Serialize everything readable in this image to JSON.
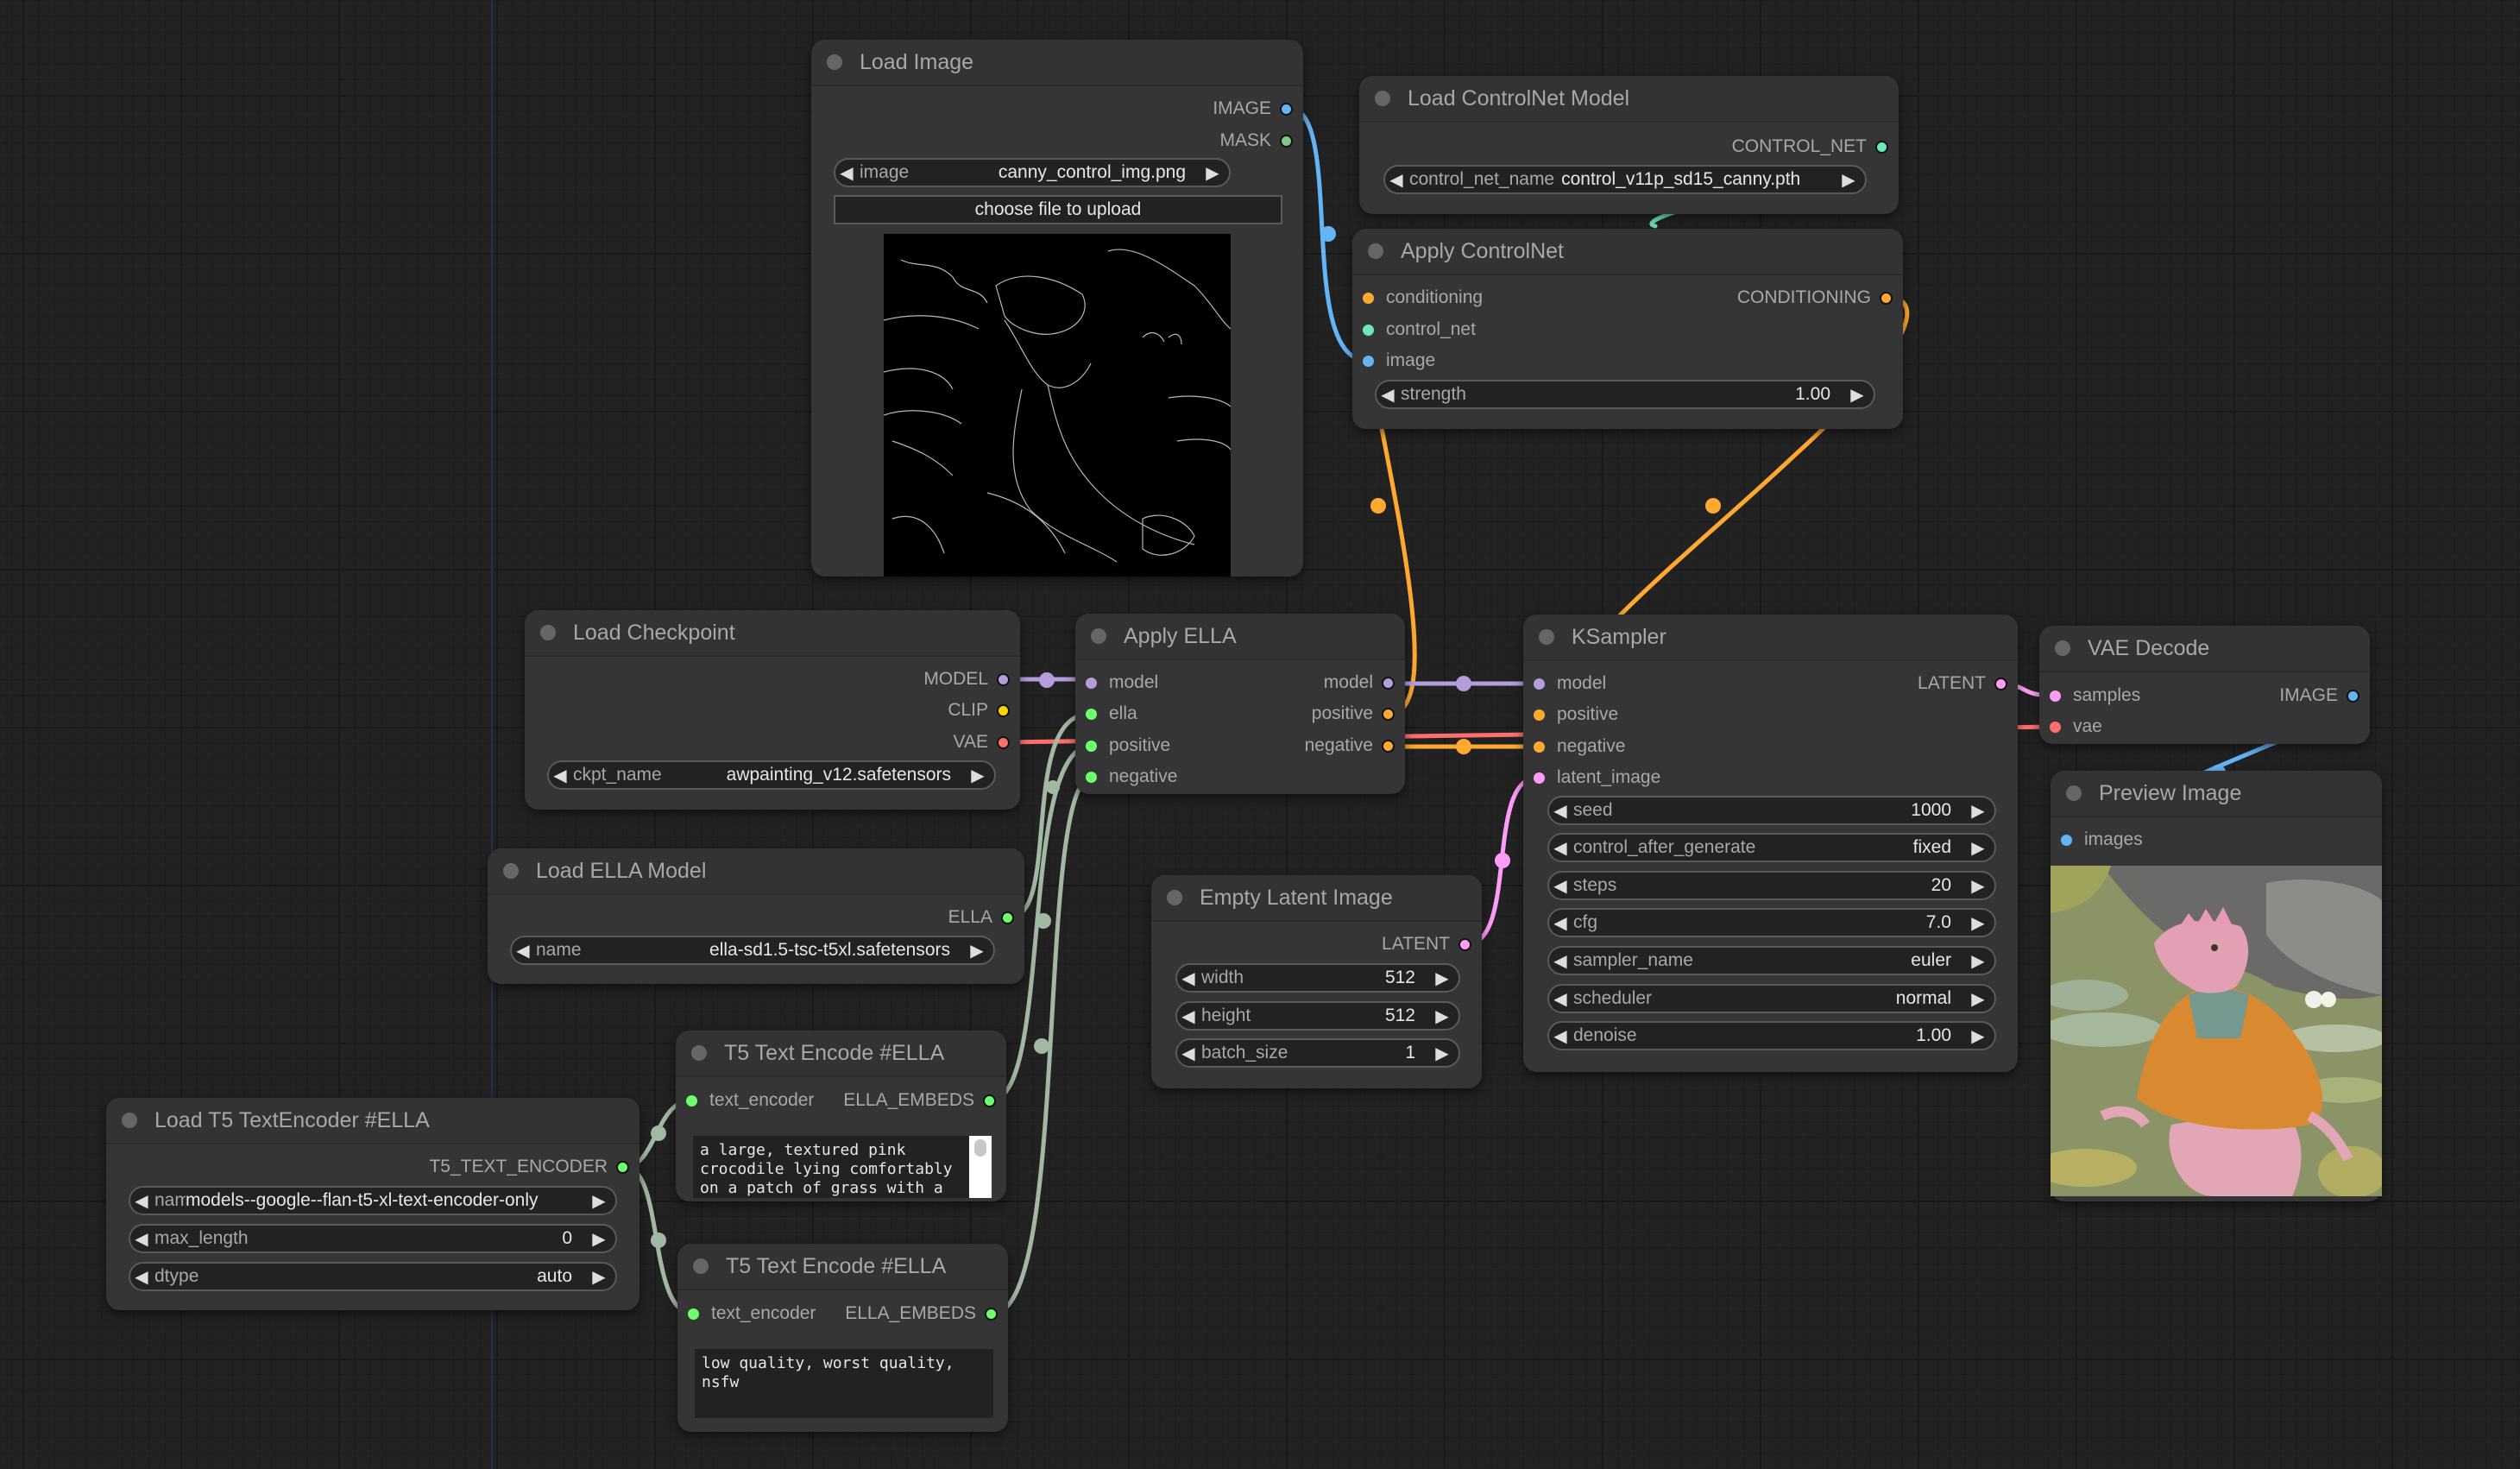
{
  "app": "ComfyUI workflow canvas",
  "colors": {
    "image": "#64b5f6",
    "mask": "#81c784",
    "control_net": "#6ee7b7",
    "conditioning": "#ffa931",
    "model": "#b39ddb",
    "clip": "#ffd500",
    "vae": "#ff6e6e",
    "latent": "#ff9cf9",
    "ella": "#6dff6d",
    "ella_wire": "#a3b8a3"
  },
  "nodes": {
    "load_image": {
      "title": "Load Image",
      "outputs": [
        "IMAGE",
        "MASK"
      ],
      "widget": {
        "label": "image",
        "value": "canny_control_img.png"
      },
      "upload_button": "choose file to upload",
      "preview_desc": "canny edge map of crocodile"
    },
    "load_controlnet": {
      "title": "Load ControlNet Model",
      "outputs": [
        "CONTROL_NET"
      ],
      "widget": {
        "label": "control_net_name",
        "value": "control_v11p_sd15_canny.pth"
      }
    },
    "apply_controlnet": {
      "title": "Apply ControlNet",
      "inputs": [
        "conditioning",
        "control_net",
        "image"
      ],
      "outputs": [
        "CONDITIONING"
      ],
      "widget": {
        "label": "strength",
        "value": "1.00"
      }
    },
    "load_checkpoint": {
      "title": "Load Checkpoint",
      "outputs": [
        "MODEL",
        "CLIP",
        "VAE"
      ],
      "widget": {
        "label": "ckpt_name",
        "value": "awpainting_v12.safetensors"
      }
    },
    "apply_ella": {
      "title": "Apply ELLA",
      "inputs": [
        "model",
        "ella",
        "positive",
        "negative"
      ],
      "outputs": [
        "model",
        "positive",
        "negative"
      ]
    },
    "ksampler": {
      "title": "KSampler",
      "inputs": [
        "model",
        "positive",
        "negative",
        "latent_image"
      ],
      "outputs": [
        "LATENT"
      ],
      "widgets": [
        {
          "label": "seed",
          "value": "1000"
        },
        {
          "label": "control_after_generate",
          "value": "fixed"
        },
        {
          "label": "steps",
          "value": "20"
        },
        {
          "label": "cfg",
          "value": "7.0"
        },
        {
          "label": "sampler_name",
          "value": "euler"
        },
        {
          "label": "scheduler",
          "value": "normal"
        },
        {
          "label": "denoise",
          "value": "1.00"
        }
      ]
    },
    "vae_decode": {
      "title": "VAE Decode",
      "inputs": [
        "samples",
        "vae"
      ],
      "outputs": [
        "IMAGE"
      ]
    },
    "preview_image": {
      "title": "Preview Image",
      "inputs": [
        "images"
      ],
      "preview_desc": "pink crocodile in orange sweater sitting in a lily pond"
    },
    "load_ella": {
      "title": "Load ELLA Model",
      "outputs": [
        "ELLA"
      ],
      "widget": {
        "label": "name",
        "value": "ella-sd1.5-tsc-t5xl.safetensors"
      }
    },
    "empty_latent": {
      "title": "Empty Latent Image",
      "outputs": [
        "LATENT"
      ],
      "widgets": [
        {
          "label": "width",
          "value": "512"
        },
        {
          "label": "height",
          "value": "512"
        },
        {
          "label": "batch_size",
          "value": "1"
        }
      ]
    },
    "t5_encode_pos": {
      "title": "T5 Text Encode #ELLA",
      "inputs": [
        "text_encoder"
      ],
      "outputs": [
        "ELLA_EMBEDS"
      ],
      "text": "a large, textured pink crocodile lying comfortably on a patch of grass with a"
    },
    "load_t5": {
      "title": "Load T5 TextEncoder #ELLA",
      "outputs": [
        "T5_TEXT_ENCODER"
      ],
      "widgets": [
        {
          "label": "name",
          "value": "models--google--flan-t5-xl-text-encoder-only"
        },
        {
          "label": "max_length",
          "value": "0"
        },
        {
          "label": "dtype",
          "value": "auto"
        }
      ]
    },
    "t5_encode_neg": {
      "title": "T5 Text Encode #ELLA",
      "inputs": [
        "text_encoder"
      ],
      "outputs": [
        "ELLA_EMBEDS"
      ],
      "text": "low quality, worst quality,\nnsfw"
    }
  },
  "widget_arrows": {
    "left": "◀",
    "right": "▶"
  }
}
